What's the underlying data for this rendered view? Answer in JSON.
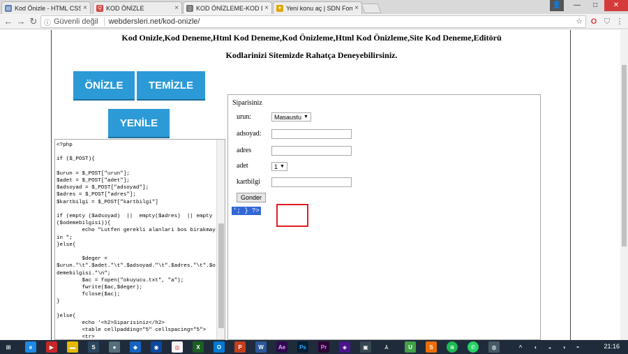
{
  "tabs": [
    {
      "title": "Kod Önizle - HTML CSS JS",
      "favicon": "page-icon",
      "color": "#5a7fb5",
      "active": false
    },
    {
      "title": "KOD ÖNİZLE",
      "favicon": "search-icon",
      "color": "#d64545",
      "active": false
    },
    {
      "title": "KOD ÖNİZLEME-KOD DENEME",
      "favicon": "page-icon",
      "color": "#777777",
      "active": true
    },
    {
      "title": "Yeni konu aç | SDN Forum",
      "favicon": "forum-icon",
      "color": "#e0a800",
      "active": false
    }
  ],
  "omnibox": {
    "security": "Güvenli değil",
    "url": "webdersleri.net/kod-onizle/"
  },
  "page": {
    "heading1": "Kod Onizle,Kod Deneme,Html Kod Deneme,Kod Önizleme,Html Kod Önizleme,Site Kod Deneme,Editörü",
    "heading2": "Kodlarinizi Sitemizde Rahatça Deneyebilirsiniz.",
    "buttons": {
      "preview": "ÖNİZLE",
      "clear": "TEMİZLE",
      "refresh": "YENİLE"
    },
    "code": "<?php\n\nif ($_POST){\n\n$urun = $_POST[\"urun\"];\n$adet = $_POST[\"adet\"];\n$adsoyad = $_POST[\"adsoyad\"];\n$adres = $_POST[\"adres\"];\n$kartbilgi = $_POST[\"kartbilgi\"]\n\nif (empty ($adsoyad)  ||  empty($adres)  || empty($odemebilgisi)){\n        echo \"Lutfen gerekli alanlari bos birakmayin \";\n}else{\n\n        $deger =\n$urun.\"\\t\".$adet.\"\\t\".$adsoyad.\"\\t\".$adres.\"\\t\".$odemebilgisi.\"\\n\";\n        $ac = fopen(\"okuyucu.txt\", \"a\");\n        fwrite($ac,$deger);\n        fclose($ac);\n}\n\n}else{\n        echo '<h2>Siparisiniz</h2>\n        <table cellpadding=\"5\" cellspacing=\"5\">\n        <tr>\n                <td>urun:</td>",
    "form": {
      "title": "Siparisiniz",
      "urun_label": "urun:",
      "urun_value": "Masaustu",
      "adsoyad_label": "adsoyad:",
      "adres_label": "adres",
      "adet_label": "adet",
      "adet_value": "1",
      "kartbilgi_label": "kartbilgi",
      "submit_label": "Gonder",
      "leaked_text": "'; } ?>"
    }
  },
  "taskbar": {
    "clock": "21:16"
  }
}
